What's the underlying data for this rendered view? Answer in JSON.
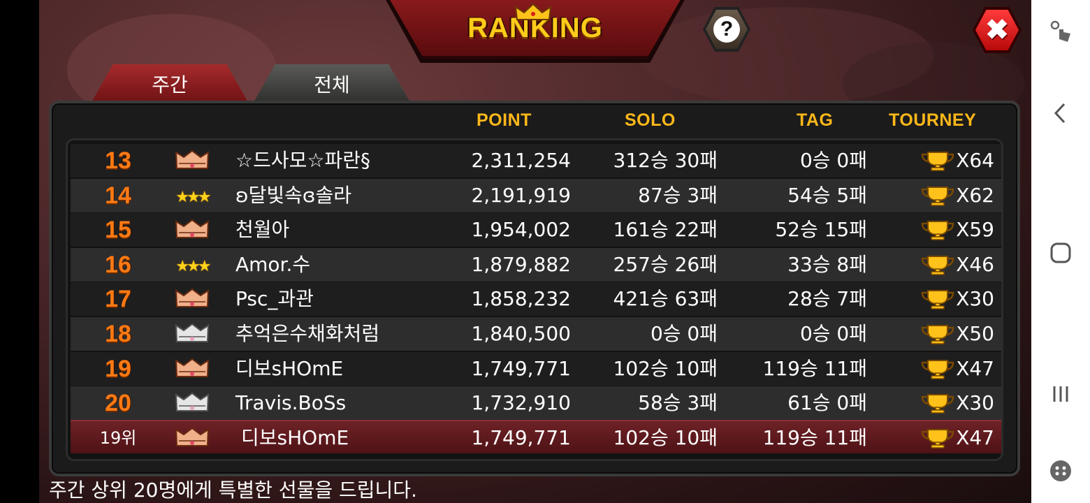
{
  "title": "RANKING",
  "tabs": [
    {
      "label": "주간",
      "active": true
    },
    {
      "label": "전체",
      "active": false
    }
  ],
  "columns": {
    "point": "POINT",
    "solo": "SOLO",
    "tag": "TAG",
    "tourney": "TOURNEY"
  },
  "rows": [
    {
      "rank": "13",
      "badge": "bronze-crown-icon",
      "name": "☆드사모☆파란§",
      "point": "2,311,254",
      "solo": "312승 30패",
      "tag": "0승 0패",
      "tourney": "X64"
    },
    {
      "rank": "14",
      "badge": "gold-stars-icon",
      "name": "ʚ달빛속ɞ솔라",
      "point": "2,191,919",
      "solo": "87승 3패",
      "tag": "54승 5패",
      "tourney": "X62"
    },
    {
      "rank": "15",
      "badge": "bronze-crown-icon",
      "name": "천월아",
      "point": "1,954,002",
      "solo": "161승 22패",
      "tag": "52승 15패",
      "tourney": "X59"
    },
    {
      "rank": "16",
      "badge": "gold-stars-icon",
      "name": "Amor.수",
      "point": "1,879,882",
      "solo": "257승 26패",
      "tag": "33승 8패",
      "tourney": "X46"
    },
    {
      "rank": "17",
      "badge": "bronze-crown-icon",
      "name": "Psc_과관",
      "point": "1,858,232",
      "solo": "421승 63패",
      "tag": "28승 7패",
      "tourney": "X30"
    },
    {
      "rank": "18",
      "badge": "silver-crown-icon",
      "name": "추억은수채화처럼",
      "point": "1,840,500",
      "solo": "0승 0패",
      "tag": "0승 0패",
      "tourney": "X50"
    },
    {
      "rank": "19",
      "badge": "bronze-crown-icon",
      "name": "디보sHOmE",
      "point": "1,749,771",
      "solo": "102승 10패",
      "tag": "119승 11패",
      "tourney": "X47"
    },
    {
      "rank": "20",
      "badge": "silver-crown-icon",
      "name": "Travis.BoSs",
      "point": "1,732,910",
      "solo": "58승 3패",
      "tag": "61승 0패",
      "tourney": "X30"
    }
  ],
  "my_row": {
    "rank": "19위",
    "badge": "bronze-crown-icon",
    "name": "디보sHOmE",
    "point": "1,749,771",
    "solo": "102승 10패",
    "tag": "119승 11패",
    "tourney": "X47"
  },
  "footer": "주간 상위 20명에게 특별한 선물을 드립니다.",
  "colors": {
    "header_gold": "#ffb81a",
    "rank_orange": "#ff7a14",
    "active_tab": "#a52a2c",
    "my_row": "#6e2226"
  }
}
